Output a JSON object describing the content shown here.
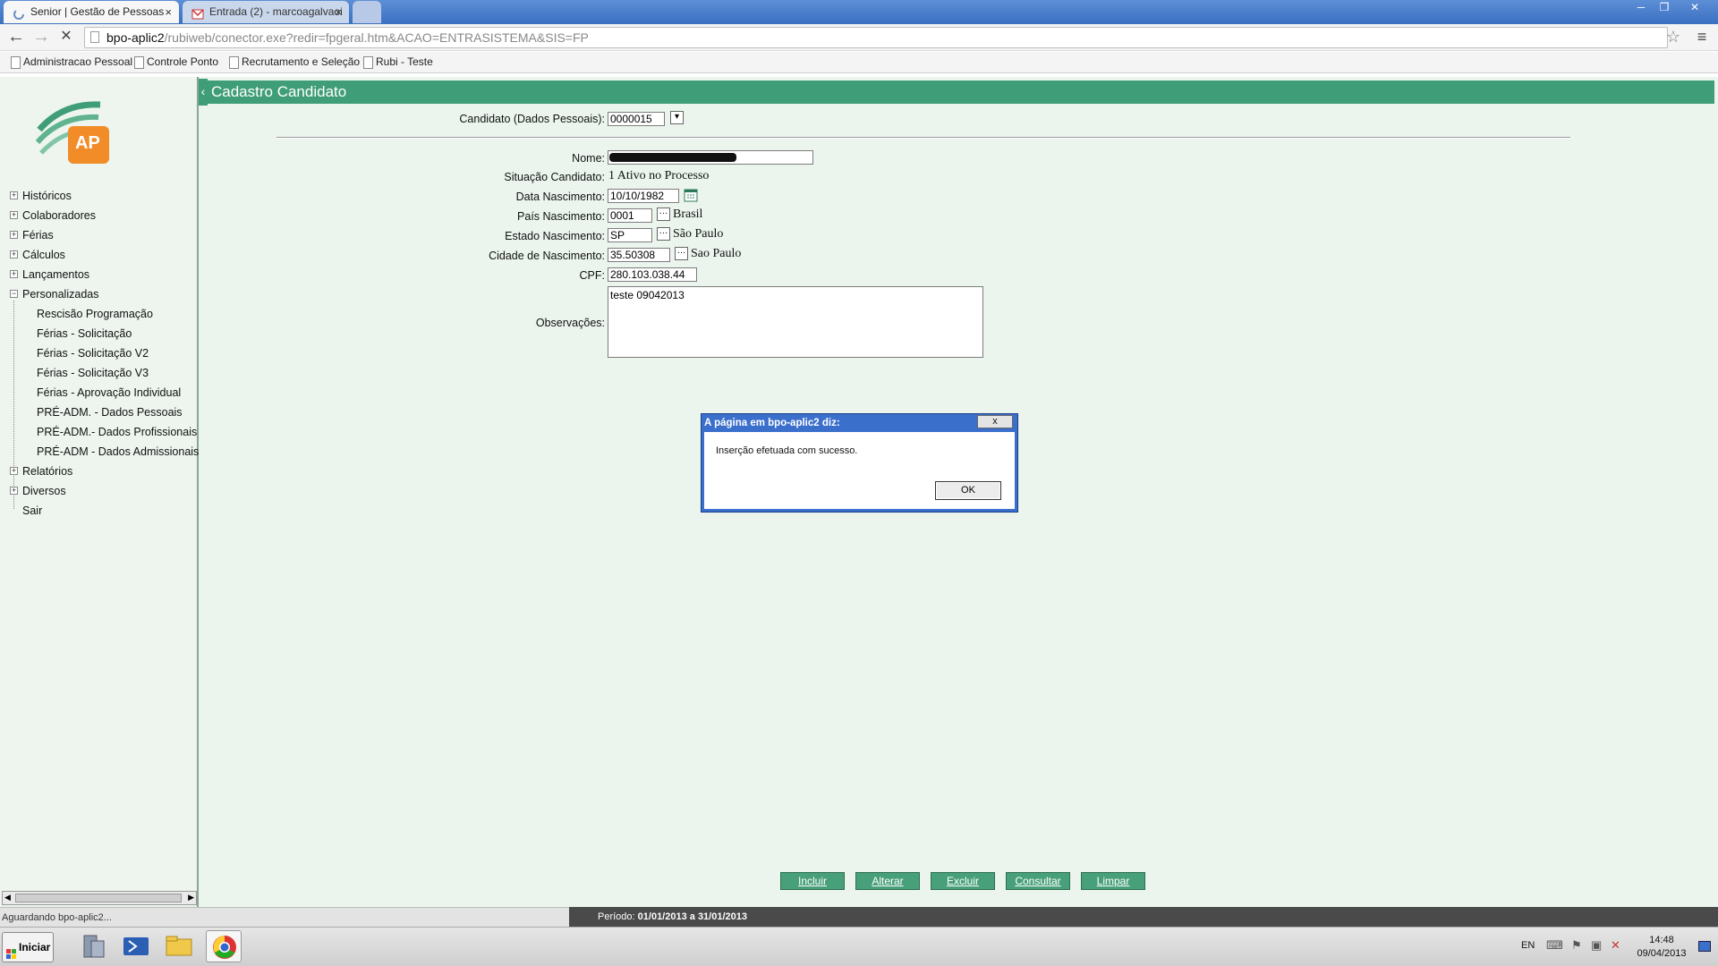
{
  "browser": {
    "tabs": [
      {
        "label": "Senior | Gestão de Pessoas"
      },
      {
        "label": "Entrada (2) - marcoagalvaoi"
      }
    ],
    "url_host": "bpo-aplic2",
    "url_path": "/rubiweb/conector.exe?redir=fpgeral.htm&ACAO=ENTRASISTEMA&SIS=FP",
    "bookmarks": [
      "Administracao Pessoal",
      "Controle Ponto",
      "Recrutamento e Seleção",
      "Rubi - Teste"
    ]
  },
  "sidebar": {
    "logo_text": "AP",
    "menu": [
      {
        "label": "Históricos",
        "expanded": false
      },
      {
        "label": "Colaboradores",
        "expanded": false
      },
      {
        "label": "Férias",
        "expanded": false
      },
      {
        "label": "Cálculos",
        "expanded": false
      },
      {
        "label": "Lançamentos",
        "expanded": false
      },
      {
        "label": "Personalizadas",
        "expanded": true
      }
    ],
    "submenu": [
      "Rescisão Programação",
      "Férias - Solicitação",
      "Férias - Solicitação V2",
      "Férias - Solicitação V3",
      "Férias - Aprovação Individual",
      "PRÉ-ADM. - Dados Pessoais",
      "PRÉ-ADM.- Dados Profissionais",
      "PRÉ-ADM - Dados Admissionais"
    ],
    "menu_after": [
      {
        "label": "Relatórios",
        "expanded": false
      },
      {
        "label": "Diversos",
        "expanded": false
      },
      {
        "label": "Sair",
        "expanded": false
      }
    ]
  },
  "form": {
    "title": "Cadastro Candidato",
    "candidato_label": "Candidato (Dados Pessoais):",
    "candidato_value": "0000015",
    "nome_label": "Nome:",
    "situacao_label": "Situação Candidato:",
    "situacao_value": "1 Ativo no Processo",
    "data_label": "Data Nascimento:",
    "data_value": "10/10/1982",
    "pais_label": "País Nascimento:",
    "pais_code": "0001",
    "pais_name": "Brasil",
    "estado_label": "Estado Nascimento:",
    "estado_code": "SP",
    "estado_name": "São Paulo",
    "cidade_label": "Cidade de Nascimento:",
    "cidade_code": "35.50308",
    "cidade_name": "Sao Paulo",
    "cpf_label": "CPF:",
    "cpf_value": "280.103.038.44",
    "obs_label": "Observações:",
    "obs_value": "teste 09042013"
  },
  "actions": {
    "incluir": "Incluir",
    "alterar": "Alterar",
    "excluir": "Excluir",
    "consultar": "Consultar",
    "limpar": "Limpar"
  },
  "status": {
    "loading": "Aguardando bpo-aplic2...",
    "period_label": "Período:",
    "period_value": "01/01/2013 a 31/01/2013"
  },
  "dialog": {
    "title": "A página em bpo-aplic2 diz:",
    "close": "x",
    "message": "Inserção efetuada com sucesso.",
    "ok": "OK"
  },
  "taskbar": {
    "start": "Iniciar",
    "lang": "EN",
    "time": "14:48",
    "date": "09/04/2013"
  }
}
